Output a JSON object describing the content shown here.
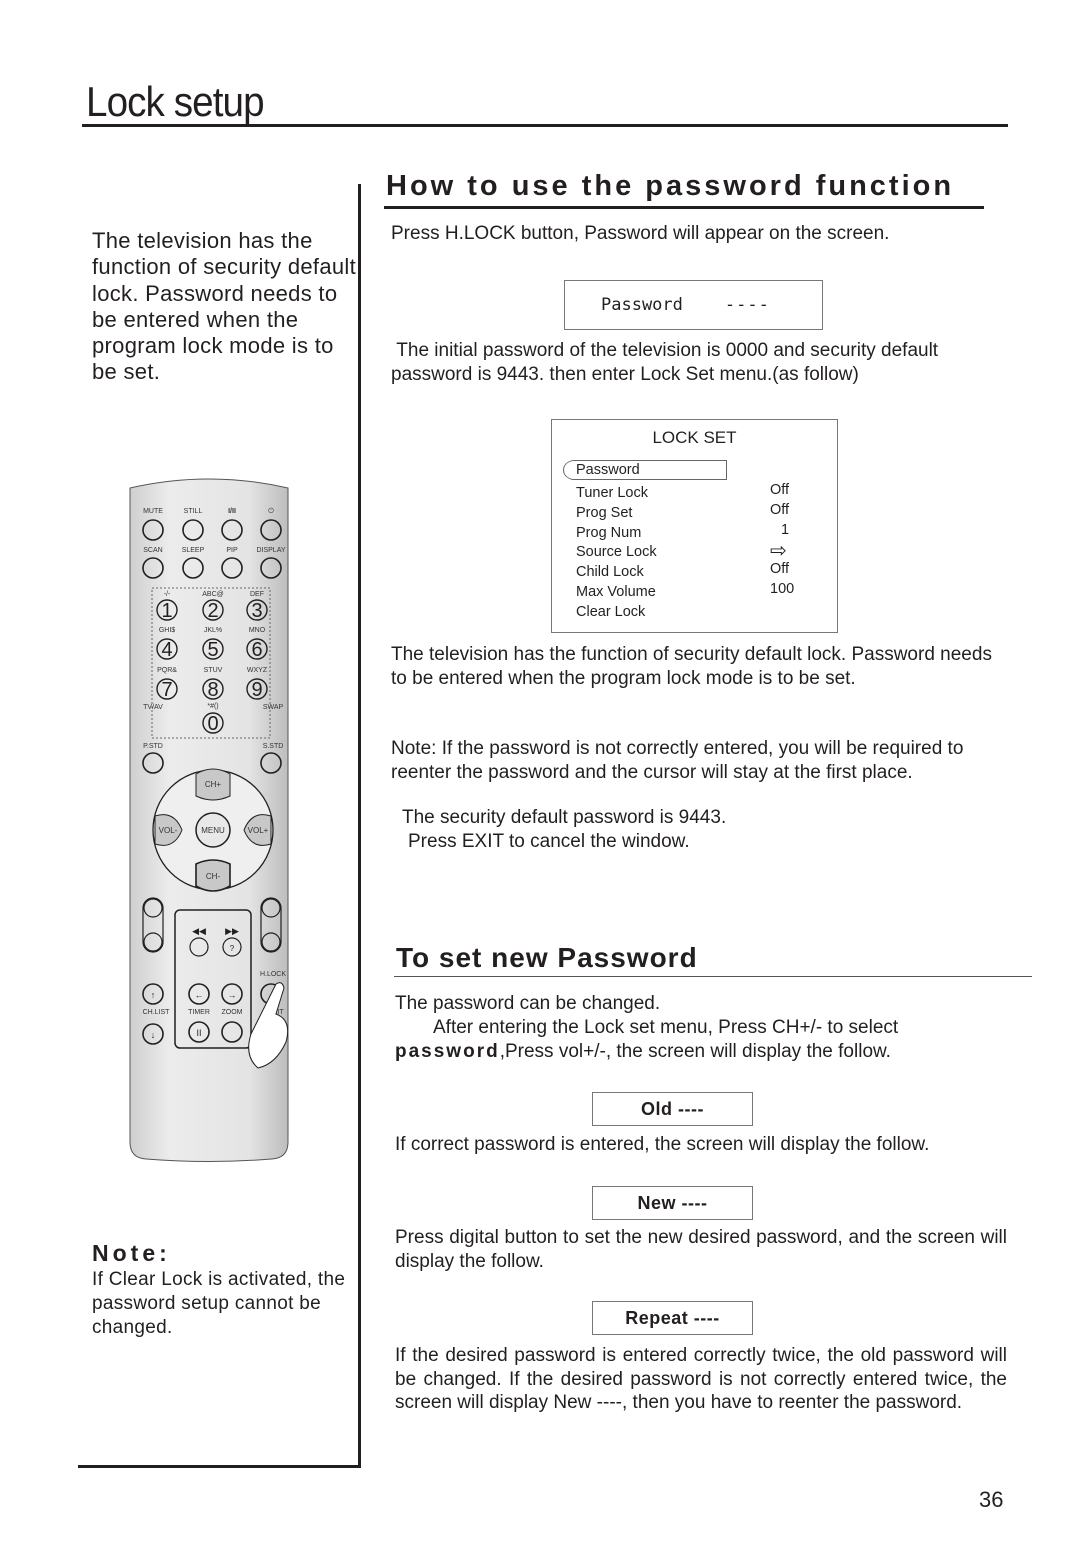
{
  "page": {
    "title": "Lock setup",
    "page_number": "36"
  },
  "left_column": {
    "intro": "The television has the function of security default lock. Password needs to be entered when the program lock mode is to be set.",
    "note_title": "Note:",
    "note_body": "If Clear Lock is activated, the password setup cannot be changed."
  },
  "remote": {
    "row1": [
      "MUTE",
      "STILL",
      "I/II",
      "power"
    ],
    "row2": [
      "SCAN",
      "SLEEP",
      "PIP",
      "DISPLAY"
    ],
    "digit_labels": [
      "-/-",
      "ABC@",
      "DEF",
      "GHI$",
      "JKL%",
      "MNO",
      "PQR&",
      "STUV",
      "WXYZ"
    ],
    "digits": [
      "1",
      "2",
      "3",
      "4",
      "5",
      "6",
      "7",
      "8",
      "9",
      "0"
    ],
    "zero_label": "*#()",
    "tvav": "TV/AV",
    "swap": "SWAP",
    "pstd": "P.STD",
    "sstd": "S.STD",
    "ch_up": "CH+",
    "ch_down": "CH-",
    "vol_down": "VOL-",
    "vol_up": "VOL+",
    "menu": "MENU",
    "hlock": "H.LOCK",
    "chlist": "CH.LIST",
    "timer": "TIMER",
    "zoom": "ZOOM",
    "exit": "EXIT"
  },
  "section1": {
    "title": "How to use the password function",
    "p1": "Press H.LOCK button, Password will appear on the screen.",
    "password_box": {
      "label": "Password",
      "value": "----"
    },
    "p2": " The initial password of the television is 0000 and security default password is 9443. then enter Lock Set menu.(as follow)",
    "lock_set": {
      "title": "LOCK SET",
      "selected": "Password",
      "items": [
        {
          "label": "Tuner Lock",
          "value": "Off"
        },
        {
          "label": "Prog Set",
          "value": "Off"
        },
        {
          "label": "Prog Num",
          "value": "1"
        },
        {
          "label": "Source Lock",
          "value": "⇨"
        },
        {
          "label": "Child Lock",
          "value": "Off"
        },
        {
          "label": "Max Volume",
          "value": "100"
        },
        {
          "label": "Clear Lock",
          "value": ""
        }
      ]
    },
    "p3": "The television has the function of security default lock. Password needs to be entered when the program lock mode is to be set.",
    "p4": "Note: If the password is not correctly entered, you will be required to reenter the password and the cursor will stay at the first place.",
    "p5": "The security default password is 9443.",
    "p6": "Press EXIT to cancel the window."
  },
  "section2": {
    "title": "To set new Password",
    "p1": "The password can be changed.",
    "p2a": "After entering the Lock set menu, Press CH+/- to select ",
    "p2_bold": "password",
    "p2b": ",Press vol+/-, the screen will display the follow.",
    "old_box": "Old  ----",
    "p3": "If correct password is entered, the screen will display the follow.",
    "new_box": "New  ----",
    "p4": "Press digital button to set the new desired password, and the screen will display the follow.",
    "repeat_box": "Repeat  ----",
    "p5": "If the desired password is entered correctly twice, the old password will be changed. If the desired password is not correctly entered twice, the screen will display New ----, then you have to reenter the password."
  }
}
